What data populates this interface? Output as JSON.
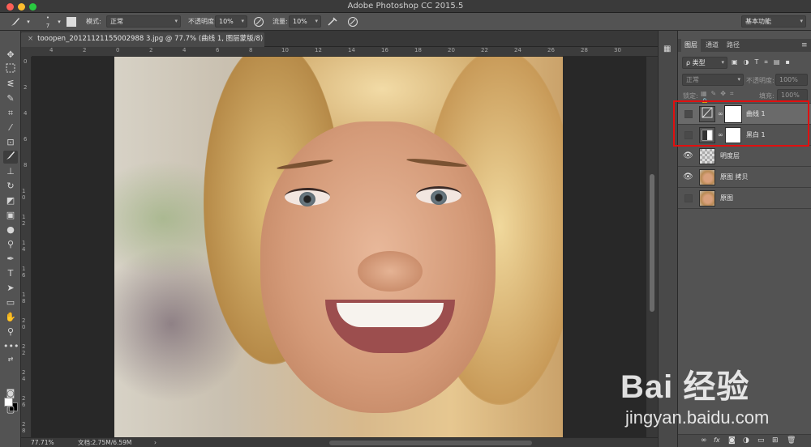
{
  "window": {
    "title": "Adobe Photoshop CC 2015.5"
  },
  "options_bar": {
    "brush_size": "7",
    "mode_label": "模式:",
    "mode_value": "正常",
    "opacity_label": "不透明度:",
    "opacity_value": "10%",
    "flow_label": "流量:",
    "flow_value": "10%",
    "workspace": "基本功能"
  },
  "document_tab": {
    "close": "×",
    "title": "tooopen_20121121155002988 3.jpg @ 77.7% (曲线 1, 图层蒙版/8) *"
  },
  "rulers": {
    "top": [
      "4",
      "2",
      "0",
      "2",
      "4",
      "6",
      "8",
      "10",
      "12",
      "14",
      "16",
      "18",
      "20",
      "22",
      "24",
      "26",
      "28",
      "30"
    ],
    "left": [
      "0",
      "2",
      "4",
      "6",
      "8",
      "1 0",
      "1 2",
      "1 4",
      "1 6",
      "1 8",
      "2 0",
      "2 2",
      "2 4",
      "2 6",
      "2 8"
    ]
  },
  "status": {
    "zoom": "77.71%",
    "doc": "文档:2.75M/6.59M",
    "arrow": "›"
  },
  "layers_panel": {
    "tabs": [
      "图层",
      "通道",
      "路径"
    ],
    "filter_label": "ρ 类型",
    "blend_mode": "正常",
    "opacity_label": "不透明度:",
    "opacity_value": "100%",
    "lock_label": "锁定:",
    "fill_label": "填充:",
    "fill_value": "100%",
    "layers": [
      {
        "name": "曲线 1",
        "visible": false,
        "type": "adjustment-curves",
        "selected": true
      },
      {
        "name": "黑白 1",
        "visible": false,
        "type": "adjustment-bw",
        "selected": false
      },
      {
        "name": "明度层",
        "visible": true,
        "type": "transparent",
        "selected": false
      },
      {
        "name": "原图 拷贝",
        "visible": true,
        "type": "photo",
        "selected": false
      },
      {
        "name": "原图",
        "visible": false,
        "type": "photo",
        "selected": false
      }
    ],
    "bottom_icons": [
      "link-icon",
      "fx-icon",
      "mask-icon",
      "adjustment-icon",
      "folder-icon",
      "new-layer-icon",
      "trash-icon"
    ]
  },
  "watermark": {
    "brand": "Bai 经验",
    "url": "jingyan.baidu.com"
  },
  "colors": {
    "highlight": "#e01010",
    "panel": "#535353",
    "canvas": "#282828"
  }
}
